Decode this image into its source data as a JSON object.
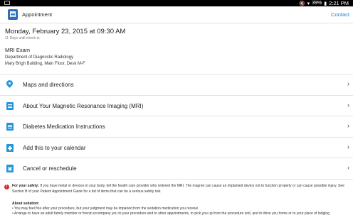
{
  "status_bar": {
    "battery": "39%",
    "time": "2:21 PM"
  },
  "action_bar": {
    "title": "Appointment",
    "contact_label": "Contact"
  },
  "appointment": {
    "datetime": "Monday, February 23, 2015 at 09:30 AM",
    "days_until": "11 Days until check-in",
    "exam": "MRI Exam",
    "department": "Department of Diagnostic Radiology",
    "location": "Mary Brigh Building, Main Floor, Desk M-F"
  },
  "menu": [
    {
      "label": "Maps and directions",
      "icon": "map-pin-icon"
    },
    {
      "label": "About Your Magnetic Resonance Imaging (MRI)",
      "icon": "document-icon"
    },
    {
      "label": "Diabetes Medication Instructions",
      "icon": "document-icon"
    },
    {
      "label": "Add this to your calendar",
      "icon": "calendar-add-icon"
    },
    {
      "label": "Cancel or reschedule",
      "icon": "calendar-cancel-icon"
    }
  ],
  "safety": {
    "heading": "For your safety:",
    "text": "If you have metal or devices in your body, tell the health care provider who ordered the MRI.  The magnet can cause an implanted device not to function properly or can cause possible injury.  See Section B of your Patient Appointment Guide for a list of items that can be a serious safety risk.",
    "sedation_title": "About sedation:",
    "sedation_1": "• You may feel fine after your procedure, but your judgment may be impaired from the sedation medication you receive",
    "sedation_2": "• Arrange to have an adult family member or friend accompany you to your procedure and to other appointments, to pick you up from the procedure unit, and to drive you home or to your place of lodging"
  },
  "colors": {
    "accent": "#2596d9",
    "link": "#1f7bd8",
    "alert": "#d32f2f"
  }
}
